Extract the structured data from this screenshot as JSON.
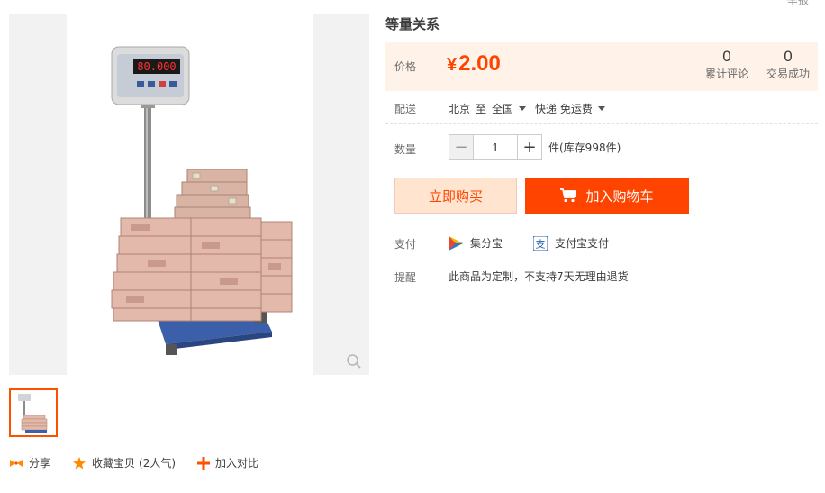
{
  "top_corner": "举报",
  "product": {
    "title": "等量关系",
    "scale_display": "80.000"
  },
  "price": {
    "label": "价格",
    "currency": "¥",
    "value": "2.00",
    "comments_count": "0",
    "comments_label": "累计评论",
    "success_count": "0",
    "success_label": "交易成功"
  },
  "delivery": {
    "label": "配送",
    "from": "北京",
    "to_word": "至",
    "dest": "全国",
    "method": "快递 免运费"
  },
  "quantity": {
    "label": "数量",
    "value": "1",
    "minus": "−",
    "plus": "+",
    "stock_text": "件(库存998件)"
  },
  "buttons": {
    "buy_now": "立即购买",
    "add_cart": "加入购物车"
  },
  "payment": {
    "label": "支付",
    "methods": [
      "集分宝",
      "支付宝支付"
    ]
  },
  "remind": {
    "label": "提醒",
    "text": "此商品为定制，不支持7天无理由退货"
  },
  "actions": {
    "share": "分享",
    "favorite": "收藏宝贝",
    "favorite_count": "(2人气)",
    "compare": "加入对比"
  },
  "colors": {
    "accent": "#ff4400",
    "price_bg": "#fff2e8",
    "buy_now_bg": "#ffe4d0"
  }
}
